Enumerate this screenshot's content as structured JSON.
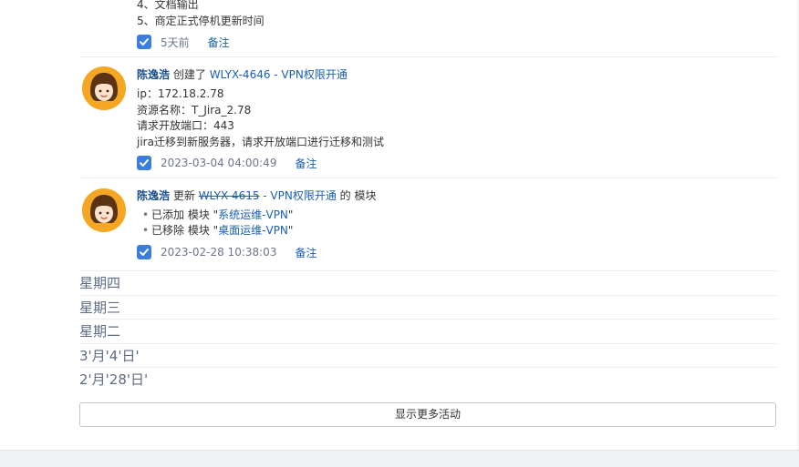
{
  "colors": {
    "link": "#1a5fb4",
    "user": "#1a4f8f",
    "checkbox": "#3b7ddd",
    "avatar_bg": "#f5a623"
  },
  "top_item": {
    "lines": [
      "4、文档输出",
      "5、商定正式停机更新时间"
    ],
    "timestamp": "5天前",
    "note": "备注"
  },
  "activities": [
    {
      "user": "陈逸浩",
      "action": "创建了",
      "issue": "WLYX-4646 - VPN权限开通",
      "lines": [
        "ip：172.18.2.78",
        "资源名称：T_Jira_2.78",
        "请求开放端口：443",
        "jira迁移到新服务器，请求开放端口进行迁移和测试"
      ],
      "timestamp": "2023-03-04 04:00:49",
      "note": "备注"
    },
    {
      "user": "陈逸浩",
      "action": "更新",
      "issue_key": "WLYX-4615",
      "issue_title": " - VPN权限开通",
      "suffix": " 的 模块",
      "changes": [
        {
          "prefix": "已添加 模块 \"",
          "value": "系统运维-VPN",
          "suffix": "\""
        },
        {
          "prefix": "已移除 模块 \"",
          "value": "桌面运维-VPN",
          "suffix": "\""
        }
      ],
      "timestamp": "2023-02-28 10:38:03",
      "note": "备注"
    }
  ],
  "day_groups": [
    "星期四",
    "星期三",
    "星期二",
    "3'月'4'日'",
    "2'月'28'日'"
  ],
  "show_more_label": "显示更多活动"
}
